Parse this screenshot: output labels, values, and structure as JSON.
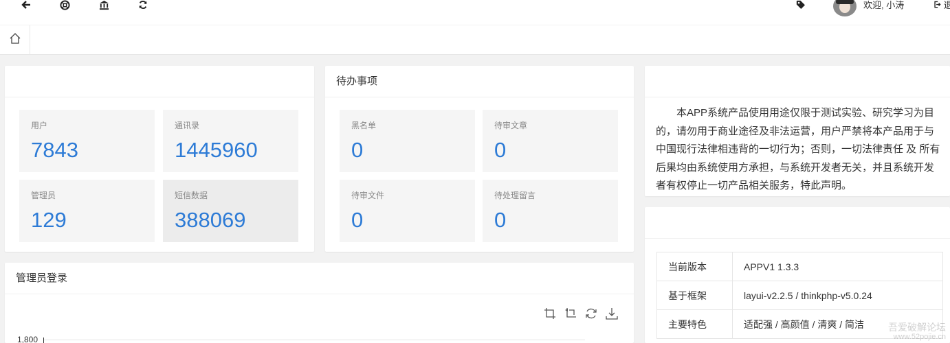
{
  "header": {
    "welcome": "欢迎, 小涛",
    "logout_label": "退",
    "icons": [
      "arrow-left-icon",
      "lifebuoy-icon",
      "bank-icon",
      "refresh-icon",
      "tag-icon",
      "logout-icon"
    ]
  },
  "stats_card": {
    "items": [
      {
        "label": "用户",
        "value": "7843"
      },
      {
        "label": "通讯录",
        "value": "1445960"
      },
      {
        "label": "管理员",
        "value": "129"
      },
      {
        "label": "短信数据",
        "value": "388069"
      }
    ]
  },
  "todo_card": {
    "title": "待办事项",
    "items": [
      {
        "label": "黑名单",
        "value": "0"
      },
      {
        "label": "待审文章",
        "value": "0"
      },
      {
        "label": "待审文件",
        "value": "0"
      },
      {
        "label": "待处理留言",
        "value": "0"
      }
    ]
  },
  "notice": {
    "text": "本APP系统产品使用用途仅限于测试实验、研究学习为目的，请勿用于商业途径及非法运营，用户严禁将本产品用于与中国现行法律相违背的一切行为；否则，一切法律责任 及 所有后果均由系统使用方承担，与系统开发者无关，并且系统开发者有权停止一切产品相关服务，特此声明。"
  },
  "version_card": {
    "rows": [
      {
        "key": "当前版本",
        "value": "APPV1 1.3.3"
      },
      {
        "key": "基于框架",
        "value": "layui-v2.2.5 / thinkphp-v5.0.24"
      },
      {
        "key": "主要特色",
        "value": "适配强 / 高颜值 / 清爽 / 简洁"
      }
    ]
  },
  "login_card": {
    "title": "管理员登录",
    "y_axis_top": "1,800"
  },
  "watermark": {
    "line1": "吾爱破解论坛",
    "line2": "www.52pojie.cn"
  },
  "colors": {
    "accent": "#2d7bd6",
    "tile": "#f5f5f5",
    "background": "#f2f2f2"
  }
}
